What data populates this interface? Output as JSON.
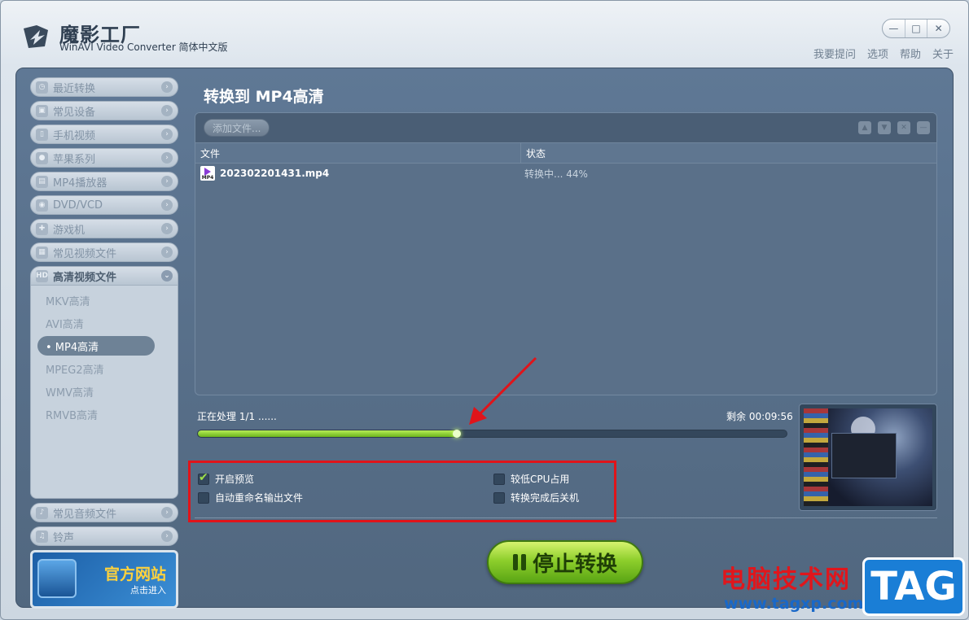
{
  "app": {
    "title": "魔影工厂",
    "subtitle": "WinAVI Video Converter 简体中文版"
  },
  "window_controls": {
    "minimize": "—",
    "maximize": "□",
    "close": "✕"
  },
  "top_menu": [
    "我要提问",
    "选项",
    "帮助",
    "关于"
  ],
  "sidebar": {
    "categories_top": [
      {
        "label": "最近转换",
        "icon": "clock-icon"
      },
      {
        "label": "常见设备",
        "icon": "device-icon"
      },
      {
        "label": "手机视频",
        "icon": "phone-icon"
      },
      {
        "label": "苹果系列",
        "icon": "apple-icon"
      },
      {
        "label": "MP4播放器",
        "icon": "mp4-player-icon"
      },
      {
        "label": "DVD/VCD",
        "icon": "disc-icon"
      },
      {
        "label": "游戏机",
        "icon": "gamepad-icon"
      },
      {
        "label": "常见视频文件",
        "icon": "video-file-icon"
      }
    ],
    "open_category": {
      "label": "高清视频文件",
      "icon": "hd-icon"
    },
    "sub_items": [
      "MKV高清",
      "AVI高清",
      "• MP4高清",
      "MPEG2高清",
      "WMV高清",
      "RMVB高清"
    ],
    "active_sub_index": 2,
    "categories_bottom": [
      {
        "label": "常见音频文件",
        "icon": "music-icon"
      },
      {
        "label": "铃声",
        "icon": "bell-icon"
      }
    ],
    "promo": {
      "title": "官方网站",
      "subtitle": "点击进入"
    }
  },
  "content": {
    "title": "转换到 MP4高清",
    "add_file_button": "添加文件...",
    "columns": [
      "文件",
      "状态"
    ],
    "files": [
      {
        "name": "202302201431.mp4",
        "status": "转换中... 44%",
        "icon_text": "MP4"
      }
    ],
    "processing_label": "正在处理 1/1 ......",
    "remaining_label": "剩余 00:09:56",
    "progress_fraction": 0.44
  },
  "options": {
    "preview": {
      "label": "开启预览",
      "checked": true
    },
    "auto_rename": {
      "label": "自动重命名输出文件",
      "checked": false
    },
    "low_cpu": {
      "label": "较低CPU占用",
      "checked": false
    },
    "shutdown": {
      "label": "转换完成后关机",
      "checked": false
    }
  },
  "stop_button": "停止转换",
  "watermark": {
    "text": "电脑技术网",
    "url": "www.tagxp.com",
    "tag": "TAG"
  },
  "colors": {
    "progress": "#8fd43a",
    "annotation_red": "#e0141a",
    "panel": "#5a7089"
  }
}
